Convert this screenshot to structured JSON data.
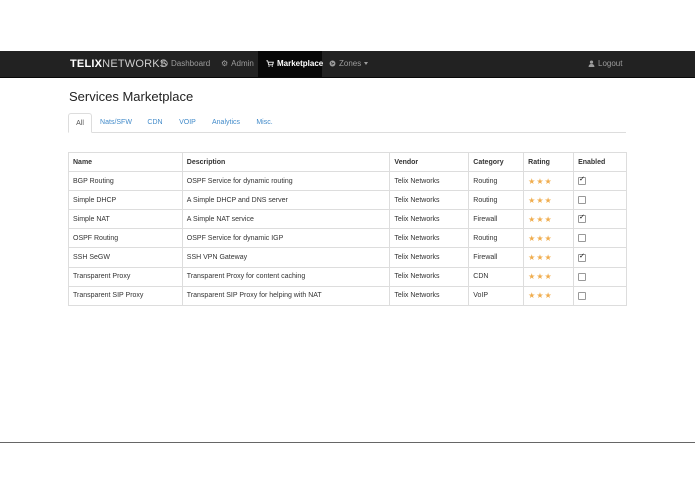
{
  "navbar": {
    "brand_bold": "TELIX",
    "brand_light": "NETWORKS",
    "items": [
      {
        "label": "Dashboard",
        "icon": "clock-icon"
      },
      {
        "label": "Admin",
        "icon": "gear-icon"
      },
      {
        "label": "Marketplace",
        "icon": "cart-icon",
        "active": true
      },
      {
        "label": "Zones",
        "icon": "globe-icon",
        "dropdown": true
      }
    ],
    "logout_label": "Logout"
  },
  "page": {
    "title": "Services Marketplace"
  },
  "tabs": [
    "All",
    "Nats/SFW",
    "CDN",
    "VOIP",
    "Analytics",
    "Misc."
  ],
  "table": {
    "headers": [
      "Name",
      "Description",
      "Vendor",
      "Category",
      "Rating",
      "Enabled"
    ],
    "rows": [
      {
        "name": "BGP Routing",
        "description": "OSPF Service for dynamic routing",
        "vendor": "Telix Networks",
        "category": "Routing",
        "rating": 3,
        "enabled": true
      },
      {
        "name": "Simple DHCP",
        "description": "A Simple DHCP and DNS server",
        "vendor": "Telix Networks",
        "category": "Routing",
        "rating": 3,
        "enabled": false
      },
      {
        "name": "Simple NAT",
        "description": "A Simple NAT service",
        "vendor": "Telix Networks",
        "category": "Firewall",
        "rating": 3,
        "enabled": true
      },
      {
        "name": "OSPF Routing",
        "description": "OSPF Service for dynamic IGP",
        "vendor": "Telix Networks",
        "category": "Routing",
        "rating": 3,
        "enabled": false
      },
      {
        "name": "SSH SeGW",
        "description": "SSH VPN Gateway",
        "vendor": "Telix Networks",
        "category": "Firewall",
        "rating": 3,
        "enabled": true
      },
      {
        "name": "Transparent Proxy",
        "description": "Transparent Proxy for content caching",
        "vendor": "Telix Networks",
        "category": "CDN",
        "rating": 3,
        "enabled": false
      },
      {
        "name": "Transparent SIP Proxy",
        "description": "Transparent SIP Proxy for helping with NAT",
        "vendor": "Telix Networks",
        "category": "VoIP",
        "rating": 3,
        "enabled": false
      }
    ]
  },
  "colors": {
    "navbar": "#222222",
    "link": "#428bca",
    "star": "#f0ad4e"
  }
}
